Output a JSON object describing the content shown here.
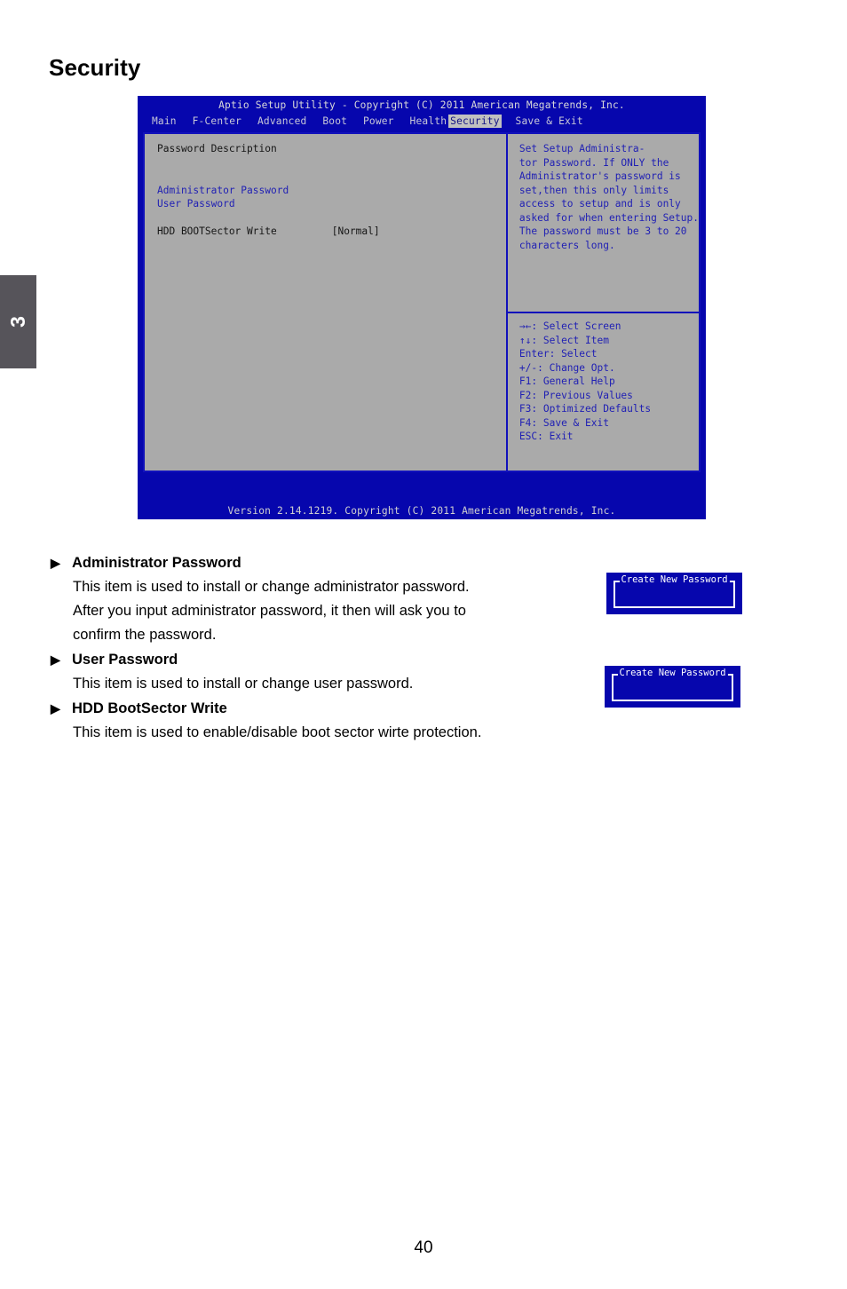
{
  "chapter": {
    "number": "3"
  },
  "page": {
    "title": "Security",
    "number": "40"
  },
  "bios": {
    "titlebar": "Aptio Setup Utility - Copyright (C) 2011 American Megatrends, Inc.",
    "menu": [
      {
        "label": "Main",
        "active": false
      },
      {
        "label": "F-Center",
        "active": false
      },
      {
        "label": "Advanced",
        "active": false
      },
      {
        "label": "Boot",
        "active": false
      },
      {
        "label": "Power",
        "active": false
      },
      {
        "label": "Health",
        "active": false
      },
      {
        "label": "Security",
        "active": true
      },
      {
        "label": "Save & Exit",
        "active": false
      }
    ],
    "left_panel": {
      "section_title": "Password Description",
      "items": [
        {
          "label": "Administrator Password",
          "value": ""
        },
        {
          "label": "User Password",
          "value": ""
        }
      ],
      "setting": {
        "label": "HDD BOOTSector Write",
        "value": "[Normal]"
      }
    },
    "right_panel": {
      "help_lines": [
        "Set Setup Administra-",
        "tor Password. If ONLY the",
        "Administrator's password is",
        "set,then this only limits",
        "access to setup and is only",
        "asked for when entering Setup.",
        "The password must be 3 to 20",
        "characters long."
      ],
      "nav_keys": [
        "→←: Select Screen",
        "↑↓: Select Item",
        "Enter: Select",
        "+/-: Change Opt.",
        "F1: General Help",
        "F2: Previous Values",
        "F3: Optimized Defaults",
        "F4: Save & Exit",
        "ESC: Exit"
      ]
    },
    "footer": "Version 2.14.1219. Copyright (C) 2011 American Megatrends, Inc."
  },
  "sections": [
    {
      "marker": "▶",
      "heading": "Administrator Password",
      "lines": [
        "This item is used to install or change administrator password.",
        "After you input administrator password, it then will ask you to",
        "confirm the password."
      ]
    },
    {
      "marker": "▶",
      "heading": "User Password",
      "lines": [
        "This item is used to install or change user password."
      ]
    },
    {
      "marker": "▶",
      "heading": "HDD BootSector Write",
      "lines": [
        "This item is used to enable/disable boot sector wirte protection."
      ]
    }
  ],
  "dialogs": [
    {
      "title": "Create New Password"
    },
    {
      "title": "Create New Password"
    }
  ],
  "colors": {
    "bios_blue": "#0606ad",
    "bios_panel_gray": "#aaaaaa",
    "bios_border_blue": "#1111bb",
    "bios_text_blue": "#1f1fb4",
    "tab_gray": "#56545a"
  }
}
